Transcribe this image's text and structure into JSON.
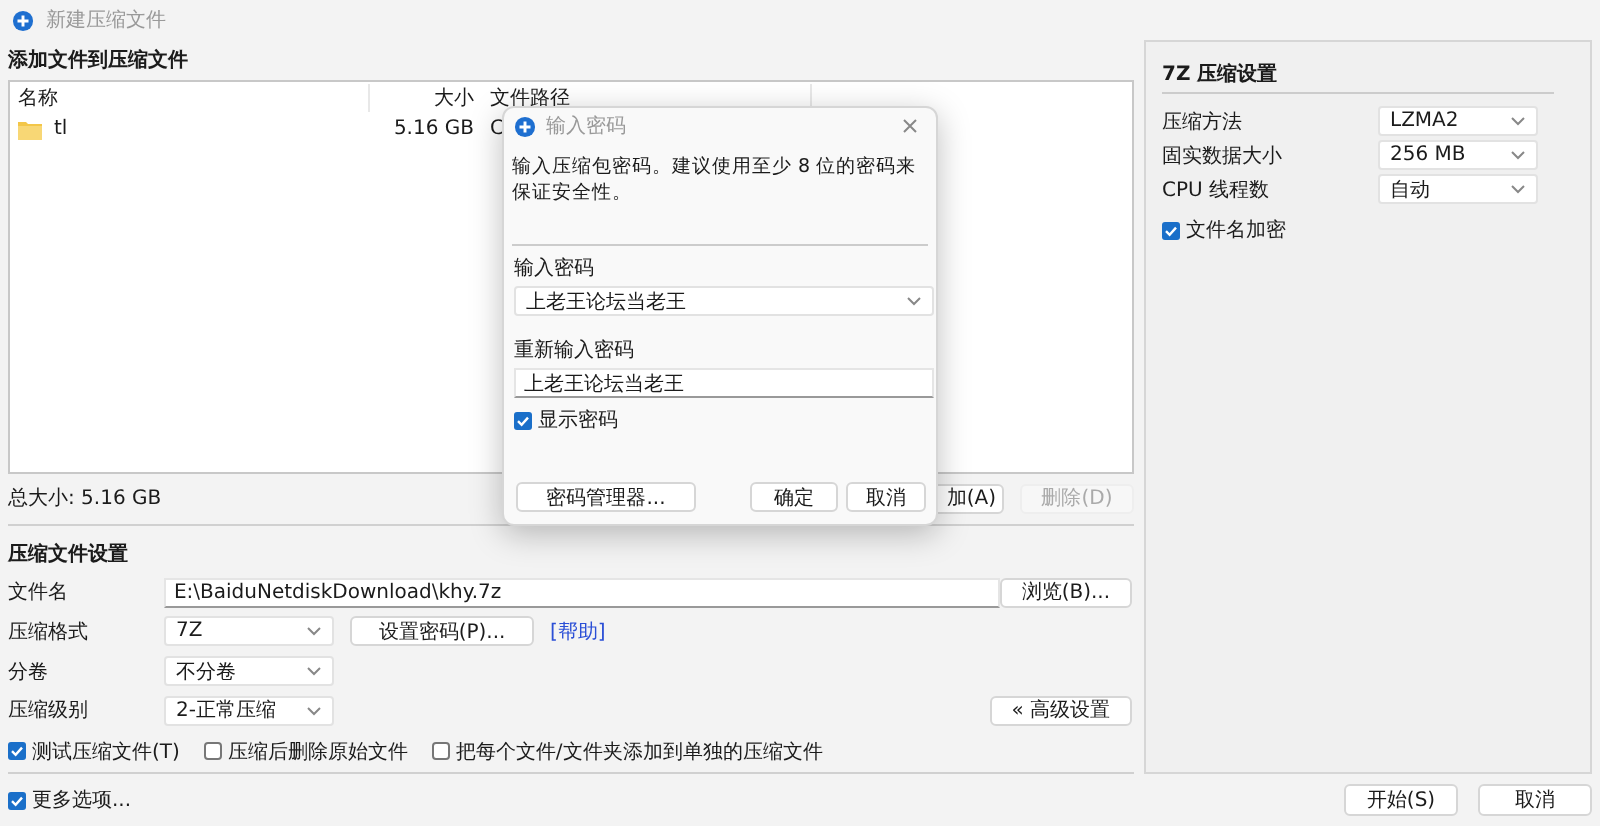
{
  "window": {
    "title": "新建压缩文件"
  },
  "files_section": {
    "title": "添加文件到压缩文件",
    "columns": [
      "名称",
      "大小",
      "文件路径"
    ],
    "rows": [
      {
        "name": "tl",
        "size": "5.16 GB",
        "path": "C"
      }
    ],
    "total": "总大小: 5.16 GB",
    "buttons": [
      {
        "label": "加(A)",
        "disabled": false
      },
      {
        "label": "删除(D)",
        "disabled": true
      }
    ]
  },
  "settings": {
    "title": "压缩文件设置",
    "fields": [
      {
        "kind": "text",
        "label": "文件名",
        "value": "E:\\BaiduNetdiskDownload\\khy.7z",
        "side_button": "浏览(B)..."
      },
      {
        "kind": "combo",
        "label": "压缩格式",
        "value": "7Z",
        "button": "设置密码(P)...",
        "link": "[帮助]"
      },
      {
        "kind": "combo",
        "label": "分卷",
        "value": "不分卷"
      },
      {
        "kind": "combo",
        "label": "压缩级别",
        "value": "2-正常压缩",
        "side_button": "« 高级设置"
      }
    ],
    "checks": [
      {
        "label": "测试压缩文件(T)",
        "checked": true
      },
      {
        "label": "压缩后删除原始文件",
        "checked": false
      },
      {
        "label": "把每个文件/文件夹添加到单独的压缩文件",
        "checked": false
      }
    ]
  },
  "format_panel": {
    "title": "7Z 压缩设置",
    "fields": [
      {
        "label": "压缩方法",
        "value": "LZMA2"
      },
      {
        "label": "固实数据大小",
        "value": "256 MB"
      },
      {
        "label": "CPU 线程数",
        "value": "自动"
      }
    ],
    "checks": [
      {
        "label": "文件名加密",
        "checked": true
      }
    ]
  },
  "footer": {
    "more_options": {
      "label": "更多选项...",
      "checked": true
    },
    "buttons": [
      "开始(S)",
      "取消"
    ]
  },
  "dialog": {
    "title": "输入密码",
    "message": "输入压缩包密码。建议使用至少 8 位的密码来保证安全性。",
    "password_label": "输入密码",
    "password": "上老王论坛当老王",
    "confirm_label": "重新输入密码",
    "confirm": "上老王论坛当老王",
    "show_password": {
      "label": "显示密码",
      "checked": true
    },
    "buttons": [
      "密码管理器...",
      "确定",
      "取消"
    ]
  }
}
